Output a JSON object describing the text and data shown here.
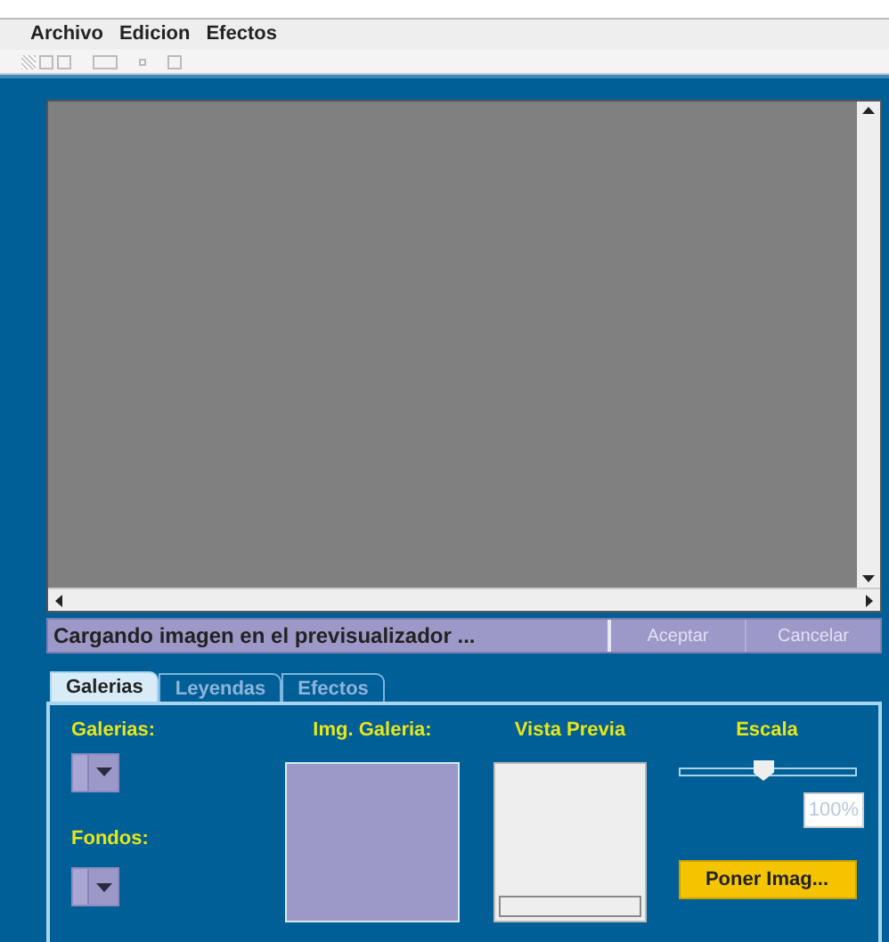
{
  "menu": [
    "Archivo",
    "Edicion",
    "Efectos"
  ],
  "status": {
    "message": "Cargando imagen en el previsualizador ...",
    "buttons": [
      {
        "label": "Aceptar",
        "disabled": true
      },
      {
        "label": "Cancelar",
        "disabled": true
      }
    ]
  },
  "tabs": [
    {
      "label": "Galerias",
      "selected": true
    },
    {
      "label": "Leyendas",
      "selected": false
    },
    {
      "label": "Efectos",
      "selected": false
    }
  ],
  "panel": {
    "galerias_label": "Galerias:",
    "fondos_label": "Fondos:",
    "img_galeria_label": "Img. Galeria:",
    "vista_previa_label": "Vista Previa",
    "progress": {
      "level": 0
    },
    "escala_label": "Escala",
    "escala": {
      "level": 0.48
    },
    "escala_value": "100%",
    "button": "Poner Imag..."
  }
}
